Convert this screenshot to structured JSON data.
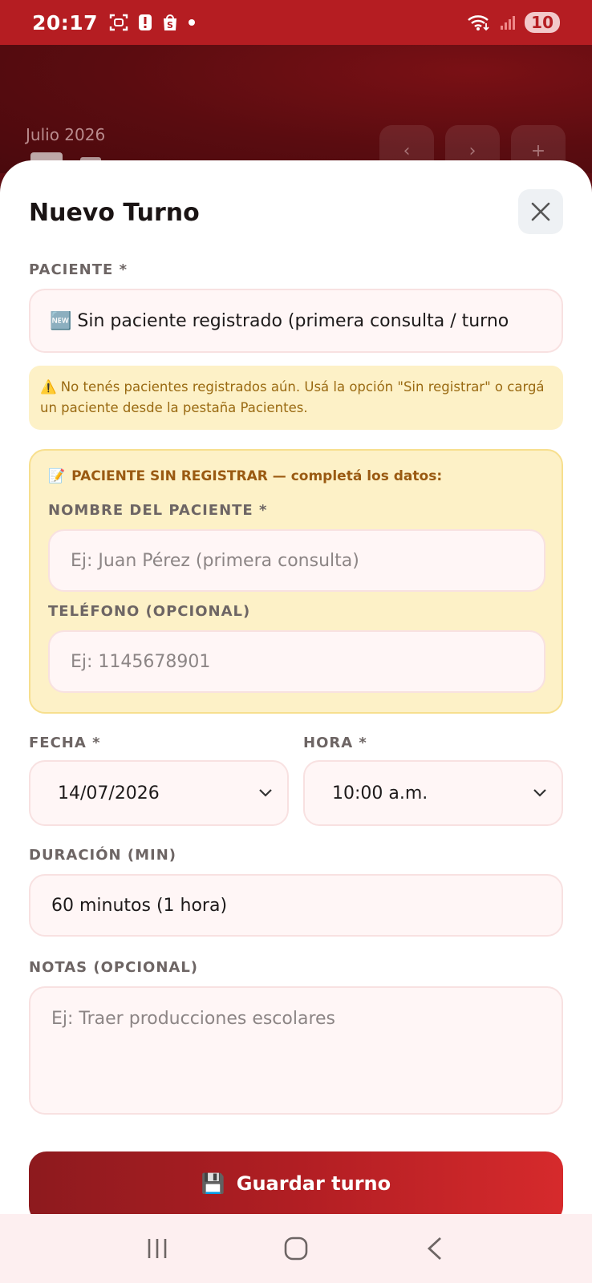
{
  "status_bar": {
    "time": "20:17",
    "battery": "10",
    "icons": [
      "screenshot-icon",
      "alert-icon",
      "shop-icon",
      "dot-icon",
      "wifi-icon",
      "signal-icon"
    ]
  },
  "background_app": {
    "month": "Julio 2026",
    "prev": "‹",
    "next": "›",
    "add": "+"
  },
  "modal": {
    "title": "Nuevo Turno",
    "patient": {
      "label": "PACIENTE *",
      "value": "🆕 Sin paciente registrado (primera consulta / turno"
    },
    "warning": "⚠️ No tenés pacientes registrados aún. Usá la opción \"Sin registrar\" o cargá un paciente desde la pestaña Pacientes.",
    "unregistered": {
      "title_icon": "📝",
      "title": "PACIENTE SIN REGISTRAR — completá los datos:",
      "name_label": "NOMBRE DEL PACIENTE *",
      "name_placeholder": "Ej: Juan Pérez (primera consulta)",
      "phone_label": "TELÉFONO (OPCIONAL)",
      "phone_placeholder": "Ej: 1145678901"
    },
    "date": {
      "label": "FECHA *",
      "value": "14/07/2026"
    },
    "time": {
      "label": "HORA *",
      "value": "10:00 a.m."
    },
    "duration": {
      "label": "DURACIÓN (MIN)",
      "value": "60 minutos (1 hora)"
    },
    "notes": {
      "label": "NOTAS (OPCIONAL)",
      "placeholder": "Ej: Traer producciones escolares"
    },
    "save_button": {
      "icon": "💾",
      "label": "Guardar turno"
    }
  },
  "colors": {
    "primary": "#b51d22",
    "warning_bg": "#fdf1c7",
    "warning_text": "#9a6a12",
    "field_bg": "#fff6f6"
  }
}
